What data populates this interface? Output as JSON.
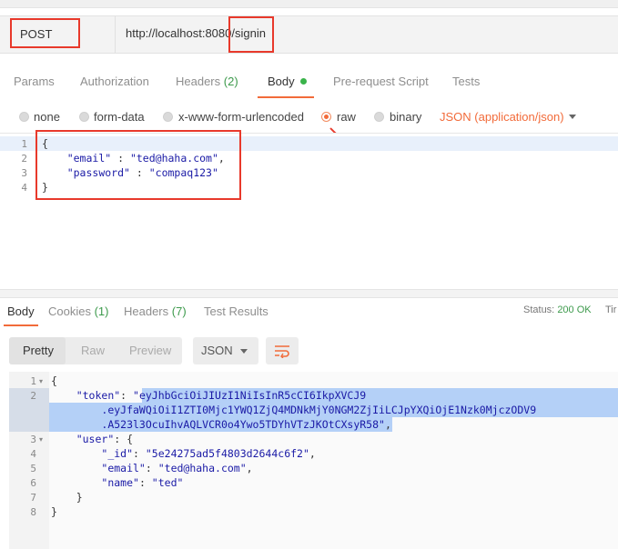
{
  "request": {
    "method": "POST",
    "url_prefix": "http://localhost:8080",
    "url_path": "/signin"
  },
  "request_tabs": [
    {
      "label": "Params",
      "count": ""
    },
    {
      "label": "Authorization",
      "count": ""
    },
    {
      "label": "Headers",
      "count": "(2)"
    },
    {
      "label": "Body",
      "count": ""
    },
    {
      "label": "Pre-request Script",
      "count": ""
    },
    {
      "label": "Tests",
      "count": ""
    }
  ],
  "body_modes": [
    "none",
    "form-data",
    "x-www-form-urlencoded",
    "raw",
    "binary"
  ],
  "selected_mode": "raw",
  "content_type": "JSON (application/json)",
  "request_body": {
    "line_numbers": [
      "1",
      "2",
      "3",
      "4"
    ],
    "open_brace": "{",
    "close_brace": "}",
    "email_key": "\"email\"",
    "email_val": "\"ted@haha.com\"",
    "password_key": "\"password\"",
    "password_val": "\"compaq123\""
  },
  "response_tabs": [
    {
      "label": "Body",
      "count": ""
    },
    {
      "label": "Cookies",
      "count": "(1)"
    },
    {
      "label": "Headers",
      "count": "(7)"
    },
    {
      "label": "Test Results",
      "count": ""
    }
  ],
  "status": {
    "label": "Status:",
    "value": "200 OK",
    "cut": "Tir"
  },
  "view_buttons": [
    "Pretty",
    "Raw",
    "Preview"
  ],
  "format": "JSON",
  "response_body": {
    "line_numbers": [
      "1",
      "2",
      "",
      "",
      "3",
      "4",
      "5",
      "6",
      "7",
      "8"
    ],
    "token_key": "\"token\"",
    "token_part1": "\"eyJhbGciOiJIUzI1NiIsInR5cCI6IkpXVCJ9",
    "token_part2": ".eyJfaWQiOiI1ZTI0Mjc1YWQ1ZjQ4MDNkMjY0NGM2ZjIiLCJpYXQiOjE1Nzk0MjczODV9",
    "token_part3": ".A523l3OcuIhvAQLVCR0o4Ywo5TDYhVTzJKOtCXsyR58\"",
    "user_key": "\"user\"",
    "id_key": "\"_id\"",
    "id_val": "\"5e24275ad5f4803d2644c6f2\"",
    "email_key": "\"email\"",
    "email_val": "\"ted@haha.com\"",
    "name_key": "\"name\"",
    "name_val": "\"ted\""
  },
  "colors": {
    "accent": "#f26b3a",
    "annotation": "#e8392b",
    "ok": "#3d9a4c",
    "json_string": "#1a1aa6"
  }
}
